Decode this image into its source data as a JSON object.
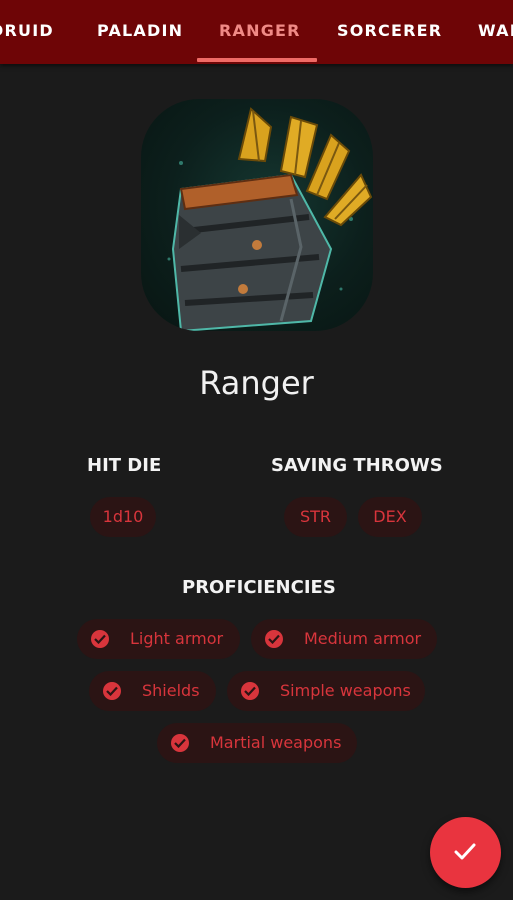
{
  "tabs": [
    {
      "label": "DRUID"
    },
    {
      "label": "PALADIN"
    },
    {
      "label": "RANGER",
      "active": true
    },
    {
      "label": "SORCERER"
    },
    {
      "label": "WARLOCK"
    }
  ],
  "class_icon": {
    "name": "quiver-icon"
  },
  "class_name": "Ranger",
  "hit_die": {
    "title": "HIT DIE",
    "value": "1d10"
  },
  "saving_throws": {
    "title": "SAVING THROWS",
    "items": [
      "STR",
      "DEX"
    ]
  },
  "proficiencies": {
    "title": "PROFICIENCIES",
    "items": [
      "Light armor",
      "Medium armor",
      "Shields",
      "Simple weapons",
      "Martial weapons"
    ]
  },
  "fab": {
    "icon": "check-icon"
  },
  "colors": {
    "app_bar": "#6e0506",
    "accent": "#e9343f",
    "chip_bg": "#2b1414",
    "chip_text": "#d8353c",
    "background": "#1b1b1b"
  }
}
